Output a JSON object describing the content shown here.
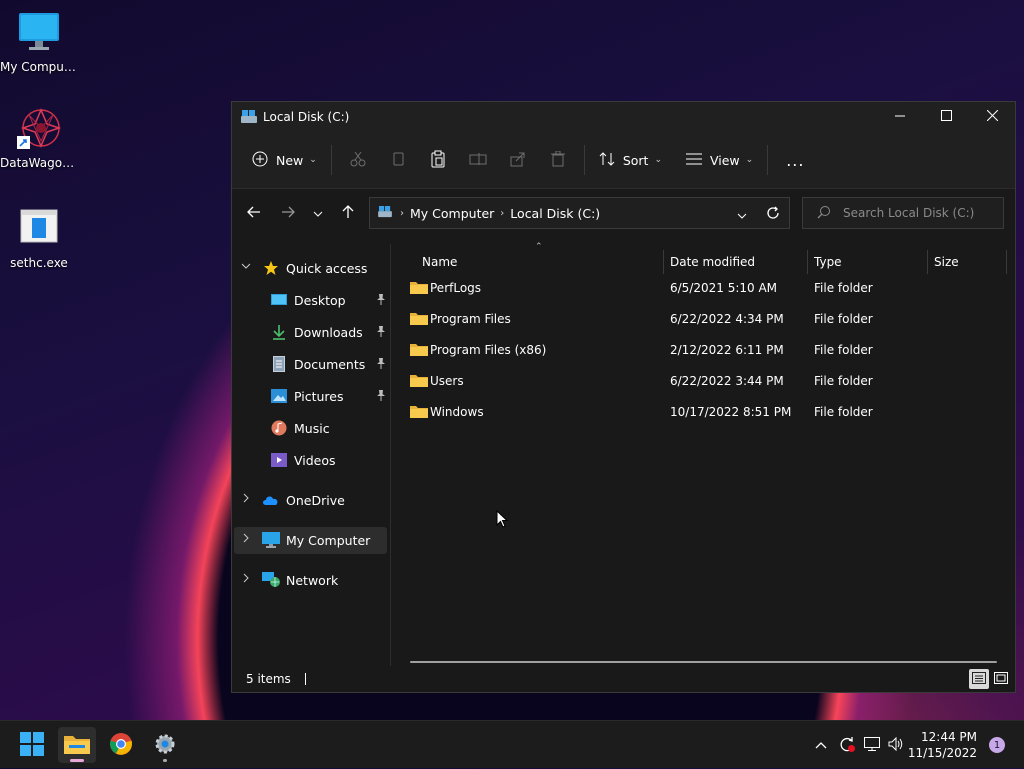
{
  "desktop": {
    "icons": [
      {
        "label": "My Computer"
      },
      {
        "label": "DataWagon..."
      },
      {
        "label": "sethc.exe"
      }
    ]
  },
  "window": {
    "title": "Local Disk (C:)",
    "controls": {
      "minimize": "minimize-icon",
      "maximize": "maximize-icon",
      "close": "close-icon"
    }
  },
  "commandbar": {
    "new_label": "New",
    "sort_label": "Sort",
    "view_label": "View",
    "more_label": "..."
  },
  "address": {
    "crumbs": [
      "My Computer",
      "Local Disk (C:)"
    ],
    "search_placeholder": "Search Local Disk (C:)"
  },
  "navpane": {
    "quick_access": "Quick access",
    "items": [
      {
        "label": "Desktop",
        "pinned": true
      },
      {
        "label": "Downloads",
        "pinned": true
      },
      {
        "label": "Documents",
        "pinned": true
      },
      {
        "label": "Pictures",
        "pinned": true
      },
      {
        "label": "Music",
        "pinned": false
      },
      {
        "label": "Videos",
        "pinned": false
      }
    ],
    "onedrive": "OneDrive",
    "mycomputer": "My Computer",
    "network": "Network"
  },
  "filelist": {
    "columns": {
      "name": "Name",
      "date": "Date modified",
      "type": "Type",
      "size": "Size"
    },
    "rows": [
      {
        "name": "PerfLogs",
        "date": "6/5/2021 5:10 AM",
        "type": "File folder"
      },
      {
        "name": "Program Files",
        "date": "6/22/2022 4:34 PM",
        "type": "File folder"
      },
      {
        "name": "Program Files (x86)",
        "date": "2/12/2022 6:11 PM",
        "type": "File folder"
      },
      {
        "name": "Users",
        "date": "6/22/2022 3:44 PM",
        "type": "File folder"
      },
      {
        "name": "Windows",
        "date": "10/17/2022 8:51 PM",
        "type": "File folder"
      }
    ]
  },
  "status": {
    "items_count": "5 items"
  },
  "taskbar": {
    "time": "12:44 PM",
    "date": "11/15/2022",
    "notification_count": "1"
  }
}
